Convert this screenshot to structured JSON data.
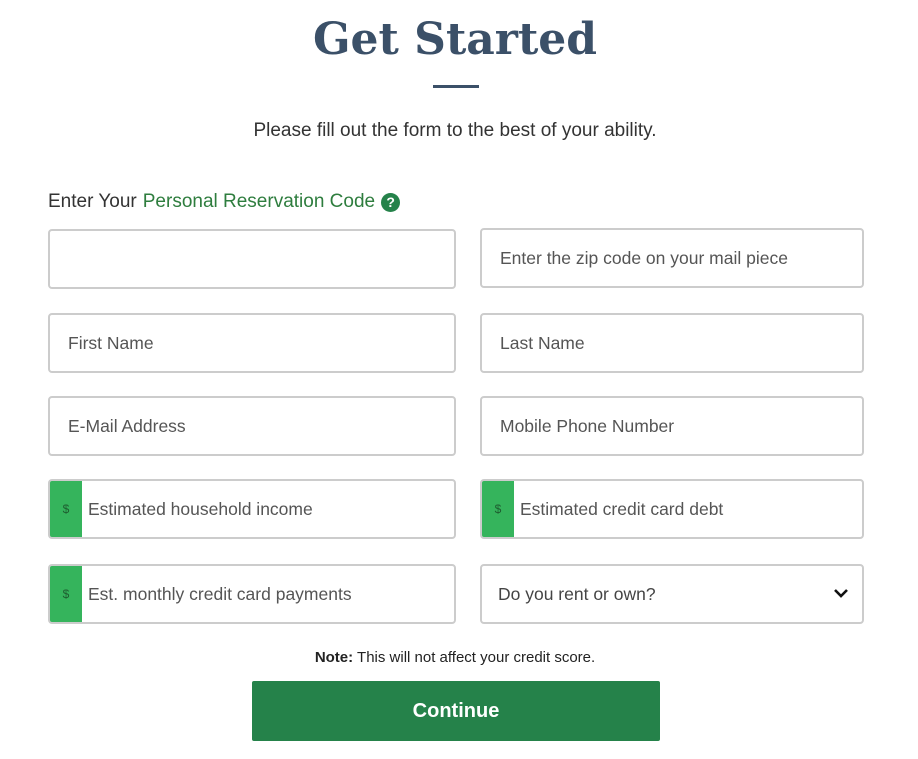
{
  "title": "Get Started",
  "subtitle": "Please fill out the form to the best of your ability.",
  "code_label": {
    "prefix": "Enter Your",
    "link": "Personal Reservation Code",
    "help_icon": "question-circle-icon"
  },
  "fields": {
    "reservation_code": {
      "value": "",
      "placeholder": ""
    },
    "zip": {
      "placeholder": "Enter the zip code on your mail piece"
    },
    "first_name": {
      "placeholder": "First Name"
    },
    "last_name": {
      "placeholder": "Last Name"
    },
    "email": {
      "placeholder": "E-Mail Address"
    },
    "phone": {
      "placeholder": "Mobile Phone Number"
    },
    "income": {
      "addon": "$",
      "placeholder": "Estimated household income"
    },
    "debt": {
      "addon": "$",
      "placeholder": "Estimated credit card debt"
    },
    "payments": {
      "addon": "$",
      "placeholder": "Est. monthly credit card payments"
    },
    "rent_own": {
      "selected": "Do you rent or own?"
    }
  },
  "note": {
    "bold": "Note:",
    "text": " This will not affect your credit score."
  },
  "continue_label": "Continue",
  "colors": {
    "heading": "#3b5068",
    "accent": "#25824a",
    "addon": "#35b45c"
  }
}
